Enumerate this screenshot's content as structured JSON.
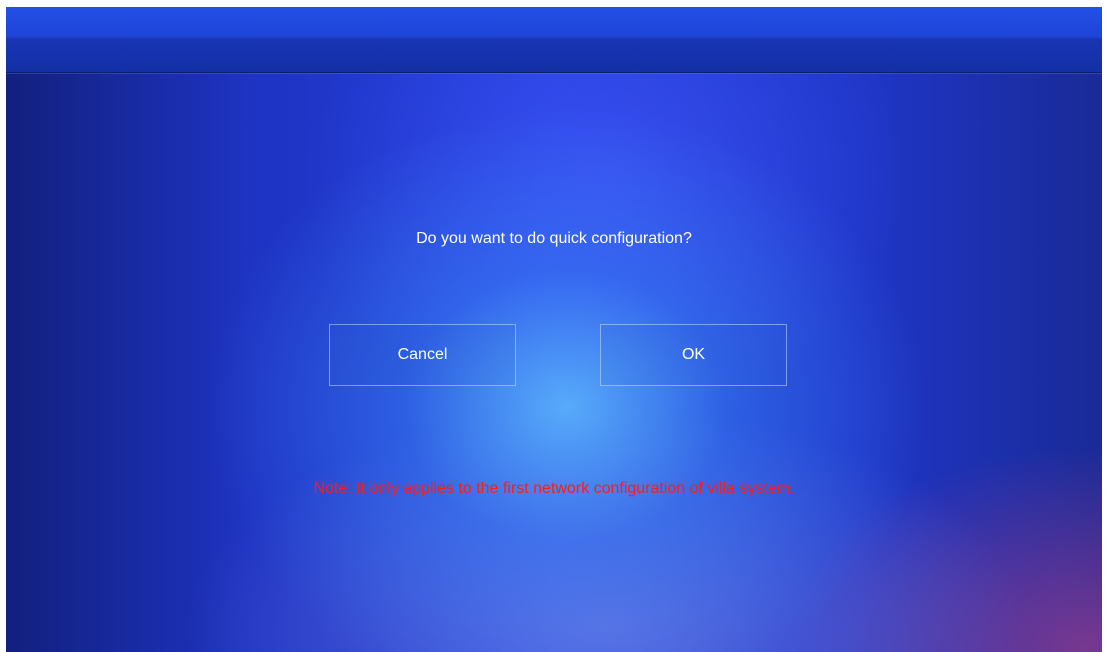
{
  "dialog": {
    "question": "Do you want to do quick configuration?",
    "cancel_label": "Cancel",
    "ok_label": "OK",
    "note": "Note: It only applies to the first network configuration of villa system."
  },
  "colors": {
    "note_text": "#ff1a1a",
    "background_primary": "#243fdd",
    "top_bar": "#1e44d8"
  }
}
